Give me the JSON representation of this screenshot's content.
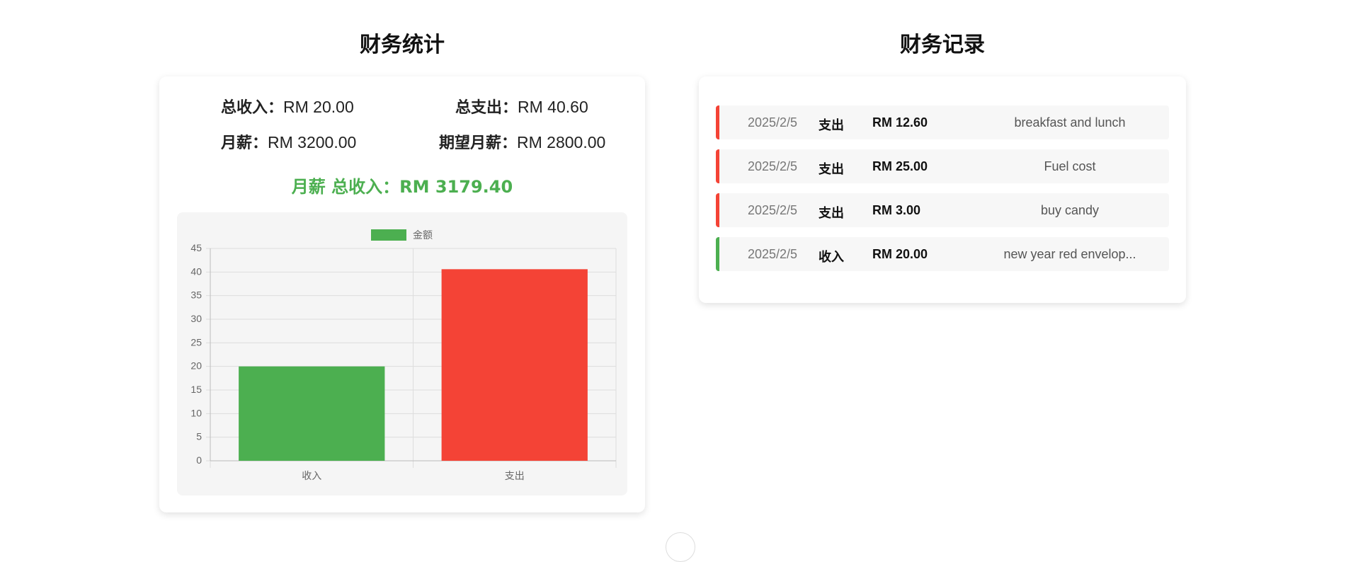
{
  "stats": {
    "title": "财务统计",
    "total_income_label": "总收入：",
    "total_income_value": "RM 20.00",
    "total_expense_label": "总支出：",
    "total_expense_value": "RM 40.60",
    "salary_label": "月薪：",
    "salary_value": "RM 3200.00",
    "expected_salary_label": "期望月薪：",
    "expected_salary_value": "RM 2800.00",
    "salary_total": "月薪 总收入：RM 3179.40"
  },
  "chart_data": {
    "type": "bar",
    "categories": [
      "收入",
      "支出"
    ],
    "series": [
      {
        "name": "金额",
        "values": [
          20,
          40.6
        ],
        "colors": [
          "#4caf50",
          "#f44336"
        ]
      }
    ],
    "legend": "top-center",
    "ylim": [
      0,
      45
    ],
    "yticks": [
      0,
      5,
      10,
      15,
      20,
      25,
      30,
      35,
      40,
      45
    ],
    "grid": true
  },
  "records": {
    "title": "财务记录",
    "items": [
      {
        "date": "2025/2/5",
        "type": "支出",
        "amount": "RM 12.60",
        "desc": "breakfast and lunch",
        "kind": "expense"
      },
      {
        "date": "2025/2/5",
        "type": "支出",
        "amount": "RM 25.00",
        "desc": "Fuel cost",
        "kind": "expense"
      },
      {
        "date": "2025/2/5",
        "type": "支出",
        "amount": "RM 3.00",
        "desc": "buy candy",
        "kind": "expense"
      },
      {
        "date": "2025/2/5",
        "type": "收入",
        "amount": "RM 20.00",
        "desc": "new year red envelop...",
        "kind": "income"
      }
    ]
  },
  "colors": {
    "income": "#4caf50",
    "expense": "#f44336"
  }
}
